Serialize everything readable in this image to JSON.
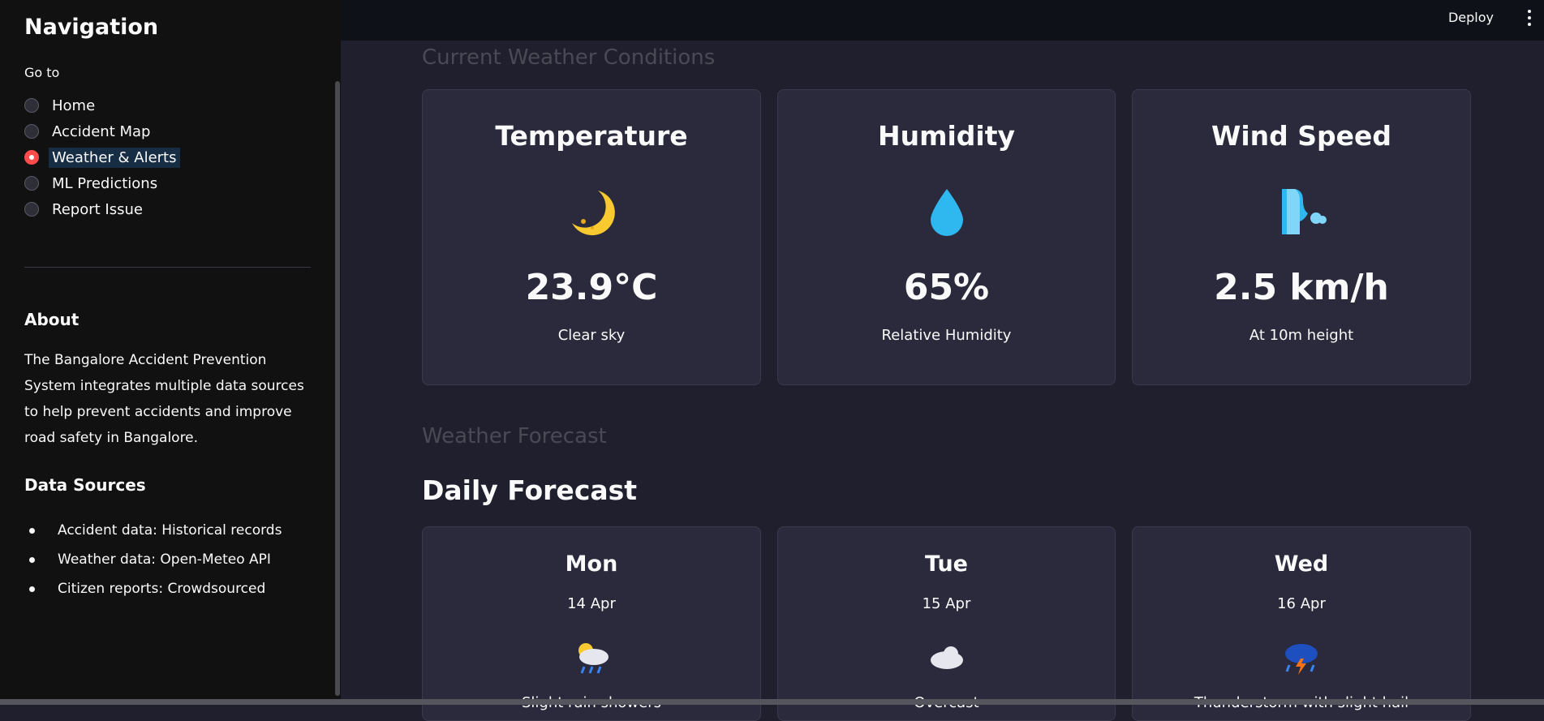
{
  "sidebar": {
    "title": "Navigation",
    "goto_label": "Go to",
    "nav_items": [
      {
        "label": "Home",
        "selected": false
      },
      {
        "label": "Accident Map",
        "selected": false
      },
      {
        "label": "Weather & Alerts",
        "selected": true
      },
      {
        "label": "ML Predictions",
        "selected": false
      },
      {
        "label": "Report Issue",
        "selected": false
      }
    ],
    "about_title": "About",
    "about_text": "The Bangalore Accident Prevention System integrates multiple data sources to help prevent accidents and improve road safety in Bangalore.",
    "data_sources_title": "Data Sources",
    "data_sources": [
      "Accident data: Historical records",
      "Weather data: Open-Meteo API",
      "Citizen reports: Crowdsourced"
    ]
  },
  "header": {
    "deploy_label": "Deploy"
  },
  "main": {
    "current_title": "Current Weather Conditions",
    "current_cards": [
      {
        "title": "Temperature",
        "icon": "moon-icon",
        "value": "23.9°C",
        "sub": "Clear sky"
      },
      {
        "title": "Humidity",
        "icon": "droplet-icon",
        "value": "65%",
        "sub": "Relative Humidity"
      },
      {
        "title": "Wind Speed",
        "icon": "wind-face-icon",
        "value": "2.5 km/h",
        "sub": "At 10m height"
      }
    ],
    "forecast_title": "Weather Forecast",
    "daily_title": "Daily Forecast",
    "daily": [
      {
        "day": "Mon",
        "date": "14 Apr",
        "icon": "sun-rain-cloud-icon",
        "condition": "Slight rain showers"
      },
      {
        "day": "Tue",
        "date": "15 Apr",
        "icon": "cloud-icon",
        "condition": "Overcast"
      },
      {
        "day": "Wed",
        "date": "16 Apr",
        "icon": "thunderstorm-icon",
        "condition": "Thunderstorm with slight hail"
      }
    ]
  },
  "colors": {
    "accent": "#ff4b4b",
    "sidebar_bg": "#111111",
    "main_bg": "#1f1f2e",
    "card_bg": "#2a2a3c"
  }
}
